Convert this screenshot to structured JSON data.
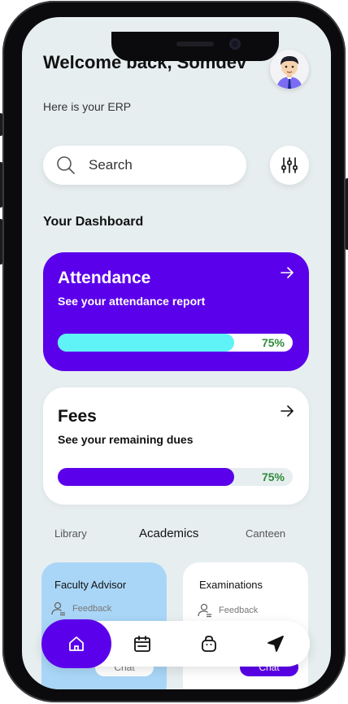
{
  "header": {
    "welcome": "Welcome back, Somdev",
    "subtitle": "Here is your ERP"
  },
  "search": {
    "label": "Search"
  },
  "dashboard": {
    "title": "Your Dashboard"
  },
  "cards": {
    "attendance": {
      "title": "Attendance",
      "subtitle": "See your attendance report",
      "progress_label": "75%",
      "progress": 0.75
    },
    "fees": {
      "title": "Fees",
      "subtitle": "See your remaining dues",
      "progress_label": "75%",
      "progress": 0.75
    }
  },
  "tabs": [
    "Library",
    "Academics",
    "Canteen"
  ],
  "active_tab": "Academics",
  "mini_cards": {
    "faculty": {
      "title": "Faculty Advisor",
      "row": "Feedback",
      "button": "Chat"
    },
    "exams": {
      "title": "Examinations",
      "row": "Feedback",
      "button": "Chat"
    }
  },
  "icons": {
    "search": "search-icon",
    "filter": "sliders-icon",
    "arrow": "arrow-right-icon",
    "nav": [
      "home-icon",
      "calendar-icon",
      "bag-icon",
      "send-icon"
    ]
  },
  "colors": {
    "primary": "#5b00ea",
    "progress_cyan": "#5ff2f7",
    "progress_green_text": "#2e8b3a",
    "faculty_card": "#a9d6f7"
  }
}
